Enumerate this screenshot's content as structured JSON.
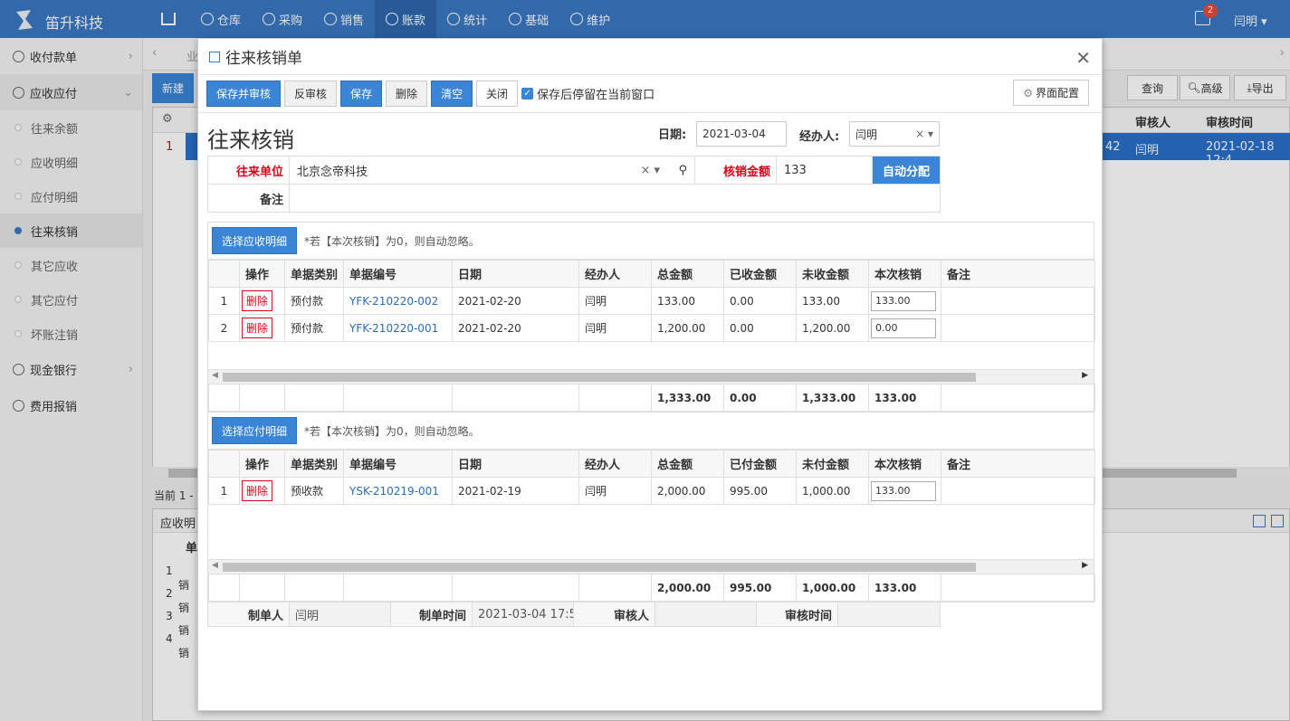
{
  "app": {
    "brand": "笛升科技",
    "user": "闫明",
    "notif_count": "2"
  },
  "nav": [
    "仓库",
    "采购",
    "销售",
    "账款",
    "统计",
    "基础",
    "维护"
  ],
  "sidebar": {
    "top": "收付款单",
    "open": "应收应付",
    "subs": [
      "往来余额",
      "应收明细",
      "应付明细",
      "往来核销",
      "其它应收",
      "其它应付",
      "坏账注销"
    ],
    "bottom": [
      "现金银行",
      "费用报销"
    ]
  },
  "bg": {
    "new_btn": "新建",
    "query_btn": "查询",
    "adv_btn": "高级",
    "export_btn": "导出",
    "col_reviewer": "审核人",
    "col_review_time": "审核时间",
    "row1_idx": "1",
    "row1_reviewer": "闫明",
    "row1_time": "2021-02-18 12:4",
    "row1_cut": "42",
    "current": "当前 1 -",
    "detail_tab": "应收明",
    "tab_cut": "业",
    "detail_col": "单",
    "detail_rows": [
      "1",
      "2",
      "3",
      "4"
    ],
    "detail_cell": "销"
  },
  "modal": {
    "title": "往来核销单",
    "toolbar": {
      "save_audit": "保存并审核",
      "unaudit": "反审核",
      "save": "保存",
      "delete": "删除",
      "clear": "清空",
      "close": "关闭",
      "stay_label": "保存后停留在当前窗口",
      "config": "界面配置"
    },
    "form_title": "往来核销",
    "date_label": "日期:",
    "date_value": "2021-03-04",
    "handler_label": "经办人:",
    "handler_value": "闫明",
    "partner_label": "往来单位",
    "partner_value": "北京念帝科技",
    "amount_label": "核销金额",
    "amount_value": "133",
    "auto_btn": "自动分配",
    "remark_label": "备注"
  },
  "recv": {
    "select_btn": "选择应收明细",
    "note": "*若【本次核销】为0，则自动忽略。",
    "headers": [
      "操作",
      "单据类别",
      "单据编号",
      "日期",
      "经办人",
      "总金额",
      "已收金额",
      "未收金额",
      "本次核销",
      "备注"
    ],
    "rows": [
      {
        "idx": "1",
        "op": "删除",
        "type": "预付款",
        "no": "YFK-210220-002",
        "date": "2021-02-20",
        "handler": "闫明",
        "total": "133.00",
        "done": "0.00",
        "undone": "133.00",
        "cur": "133.00"
      },
      {
        "idx": "2",
        "op": "删除",
        "type": "预付款",
        "no": "YFK-210220-001",
        "date": "2021-02-20",
        "handler": "闫明",
        "total": "1,200.00",
        "done": "0.00",
        "undone": "1,200.00",
        "cur": "0.00"
      }
    ],
    "sum": {
      "total": "1,333.00",
      "done": "0.00",
      "undone": "1,333.00",
      "cur": "133.00"
    }
  },
  "pay": {
    "select_btn": "选择应付明细",
    "note": "*若【本次核销】为0，则自动忽略。",
    "headers": [
      "操作",
      "单据类别",
      "单据编号",
      "日期",
      "经办人",
      "总金额",
      "已付金额",
      "未付金额",
      "本次核销",
      "备注"
    ],
    "rows": [
      {
        "idx": "1",
        "op": "删除",
        "type": "预收款",
        "no": "YSK-210219-001",
        "date": "2021-02-19",
        "handler": "闫明",
        "total": "2,000.00",
        "done": "995.00",
        "undone": "1,000.00",
        "cur": "133.00"
      }
    ],
    "sum": {
      "total": "2,000.00",
      "done": "995.00",
      "undone": "1,000.00",
      "cur": "133.00"
    }
  },
  "footer": {
    "maker_label": "制单人",
    "maker_value": "闫明",
    "make_time_label": "制单时间",
    "make_time_value": "2021-03-04 17:5",
    "auditor_label": "审核人",
    "audit_time_label": "审核时间"
  }
}
